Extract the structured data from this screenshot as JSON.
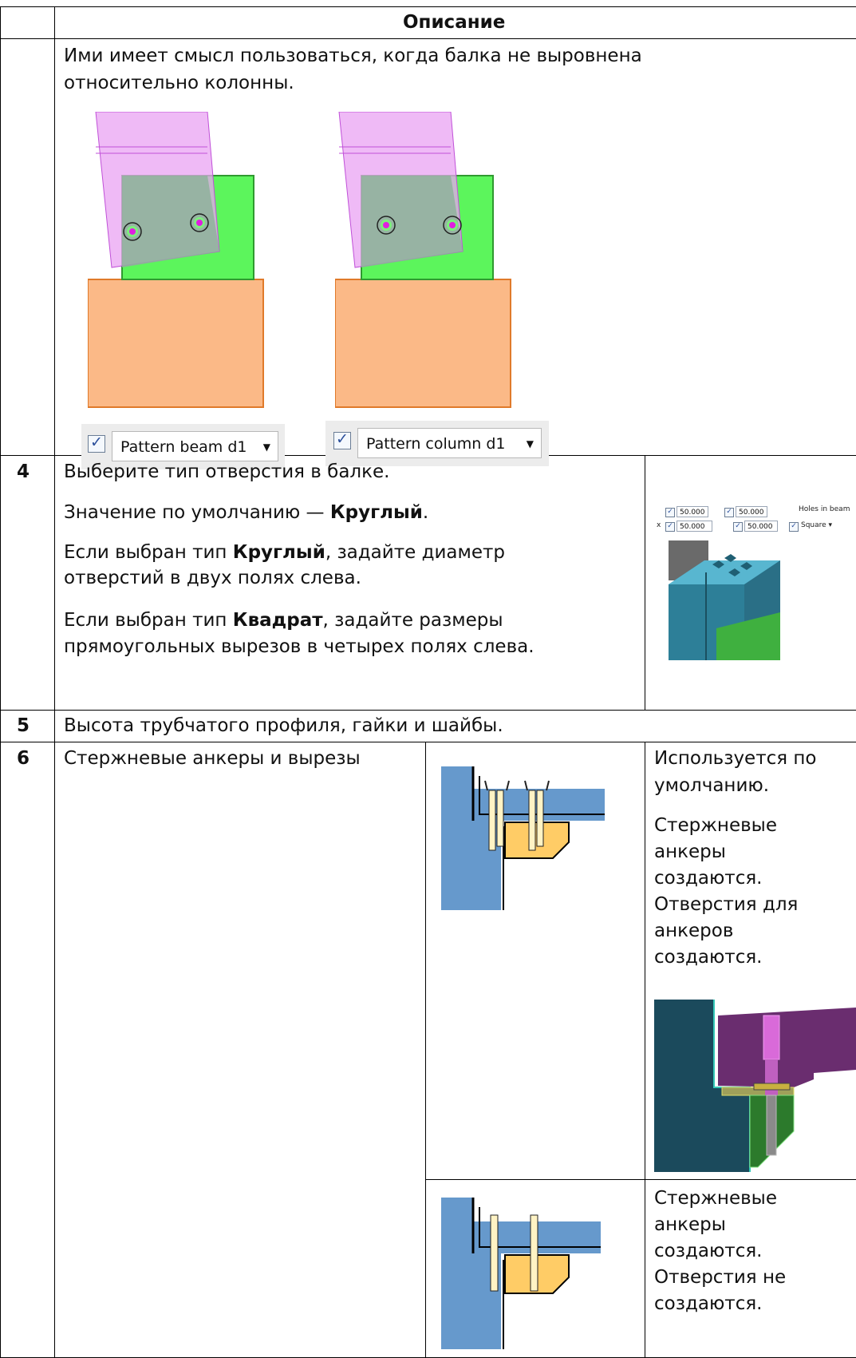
{
  "header": {
    "description": "Описание"
  },
  "row_top": {
    "text_line1": "Ими имеет смысл пользоваться, когда балка не выровнена",
    "text_line2": "относительно колонны.",
    "option_left": "Pattern beam d1",
    "option_right": "Pattern column d1"
  },
  "row4": {
    "number": "4",
    "p1": "Выберите тип отверстия в балке.",
    "p2_prefix": "Значение по умолчанию — ",
    "p2_bold": "Круглый",
    "p2_suffix": ".",
    "p3_prefix": "Если выбран тип ",
    "p3_bold": "Круглый",
    "p3_rest1": ", задайте диаметр",
    "p3_line2": "отверстий в двух полях слева.",
    "p4_prefix": "Если выбран тип ",
    "p4_bold": "Квадрат",
    "p4_rest1": ", задайте размеры",
    "p4_line2": "прямоугольных вырезов в четырех полях слева.",
    "panel": {
      "v1": "50.000",
      "v2": "50.000",
      "v3": "50.000",
      "v4": "50.000",
      "x_label": "x",
      "holes_label": "Holes in beam",
      "type": "Square"
    }
  },
  "row5": {
    "number": "5",
    "text": "Высота трубчатого профиля, гайки и шайбы."
  },
  "row6": {
    "number": "6",
    "label": "Стержневые анкеры и вырезы",
    "opt1": {
      "l1": "Используется по",
      "l2": "умолчанию.",
      "l3": "Стержневые",
      "l4": "анкеры",
      "l5": "создаются.",
      "l6": "Отверстия для",
      "l7": "анкеров",
      "l8": "создаются."
    },
    "opt2": {
      "l1": "Стержневые",
      "l2": "анкеры",
      "l3": "создаются.",
      "l4": "Отверстия не",
      "l5": "создаются."
    }
  }
}
